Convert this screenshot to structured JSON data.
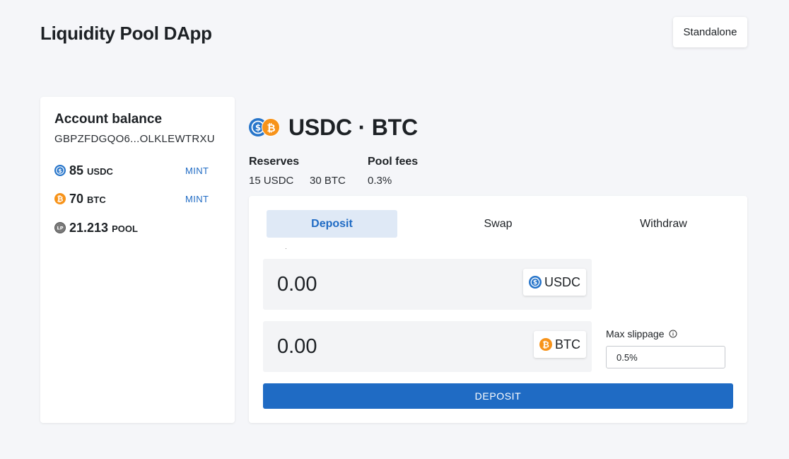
{
  "header": {
    "title": "Liquidity Pool DApp",
    "network_label": "Standalone"
  },
  "balance": {
    "title": "Account balance",
    "address": "GBPZFDGQO6...OLKLEWTRXU",
    "items": [
      {
        "amount": "85",
        "symbol": "USDC",
        "icon": "usdc-icon",
        "action": "MINT"
      },
      {
        "amount": "70",
        "symbol": "BTC",
        "icon": "btc-icon",
        "action": "MINT"
      },
      {
        "amount": "21.213",
        "symbol": "POOL",
        "icon": "lp-icon",
        "icon_text": "LP",
        "action": ""
      }
    ]
  },
  "pool": {
    "title": "USDC · BTC",
    "reserves_label": "Reserves",
    "reserves": [
      "15 USDC",
      "30 BTC"
    ],
    "fees_label": "Pool fees",
    "fees": "0.3%"
  },
  "tabs": [
    {
      "label": "Deposit",
      "active": true
    },
    {
      "label": "Swap",
      "active": false
    },
    {
      "label": "Withdraw",
      "active": false
    }
  ],
  "form": {
    "amount_a": "0.00",
    "token_a": "USDC",
    "amount_b": "0.00",
    "token_b": "BTC",
    "slippage_label": "Max slippage",
    "slippage_value": "0.5%",
    "submit_label": "DEPOSIT"
  },
  "colors": {
    "accent": "#1f6bc4",
    "usdc": "#2775ca",
    "btc": "#f7931a",
    "lp": "#7a7a7a"
  }
}
